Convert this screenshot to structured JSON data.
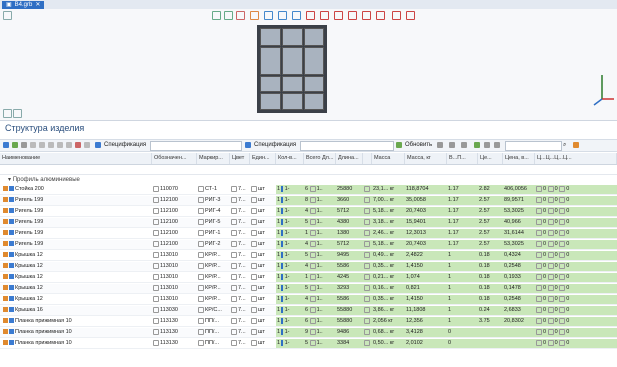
{
  "tab": {
    "title": "B4.grb",
    "close": "✕"
  },
  "panel": {
    "title": "Структура изделия"
  },
  "toolbar": {
    "spec_left": "Спецификация",
    "spec_right": "Спецификация",
    "refresh": "Обновить"
  },
  "columns": [
    "Наименование",
    "Обозначен...",
    "Маркир...",
    "Цвет",
    "Един...",
    "Кол-в...",
    "Всего Дл...",
    "Длина...",
    "",
    "Масса",
    "Масса, кг",
    "В...П...",
    "Це...",
    "Цена, в...",
    "Ц...Ц...Ц...Ц..."
  ],
  "group": "Профиль алюминиевые",
  "rows": [
    {
      "name": "Стойка 200",
      "code": "110070",
      "mark": "СТ-1",
      "unit": "шт",
      "qty": "1",
      "count": "6",
      "total": "25880",
      "len": "23,1... кг",
      "mass": "118,8704",
      "m2": "1.17",
      "price": "2.82",
      "sum": "406,0056"
    },
    {
      "name": "Ригель 199",
      "code": "112100",
      "mark": "РИГ-3",
      "unit": "шт",
      "qty": "1",
      "count": "8",
      "total": "3660",
      "len": "7,00... кг",
      "mass": "35,0058",
      "m2": "1.17",
      "price": "2.57",
      "sum": "89,9571"
    },
    {
      "name": "Ригель 199",
      "code": "112100",
      "mark": "РИГ-4",
      "unit": "шт",
      "qty": "1",
      "count": "4",
      "total": "5712",
      "len": "5,18... кг",
      "mass": "20,7403",
      "m2": "1.17",
      "price": "2.57",
      "sum": "53,3025"
    },
    {
      "name": "Ригель 199",
      "code": "112100",
      "mark": "РИГ-5",
      "unit": "шт",
      "qty": "1",
      "count": "5",
      "total": "4380",
      "len": "3,18... кг",
      "mass": "15,9401",
      "m2": "1.17",
      "price": "2.57",
      "sum": "40,966"
    },
    {
      "name": "Ригель 199",
      "code": "112100",
      "mark": "РИГ-1",
      "unit": "шт",
      "qty": "1",
      "count": "1",
      "total": "1380",
      "len": "2,46... кг",
      "mass": "12,3013",
      "m2": "1.17",
      "price": "2.57",
      "sum": "31,6144"
    },
    {
      "name": "Ригель 199",
      "code": "112100",
      "mark": "РИГ-2",
      "unit": "шт",
      "qty": "1",
      "count": "4",
      "total": "5712",
      "len": "5,18... кг",
      "mass": "20,7403",
      "m2": "1.17",
      "price": "2.57",
      "sum": "53,3025"
    },
    {
      "name": "Крышка 12",
      "code": "113010",
      "mark": "КР/Р...",
      "unit": "шт",
      "qty": "1",
      "count": "5",
      "total": "9495",
      "len": "0,49... кг",
      "mass": "2,4822",
      "m2": "1",
      "price": "0.18",
      "sum": "0,4324"
    },
    {
      "name": "Крышка 12",
      "code": "113010",
      "mark": "КР/Р...",
      "unit": "шт",
      "qty": "1",
      "count": "4",
      "total": "5586",
      "len": "0,35... кг",
      "mass": "1,4150",
      "m2": "1",
      "price": "0.18",
      "sum": "0,2548"
    },
    {
      "name": "Крышка 12",
      "code": "113010",
      "mark": "КР/Р...",
      "unit": "шт",
      "qty": "1",
      "count": "1",
      "total": "4245",
      "len": "0,21... кг",
      "mass": "1,074",
      "m2": "1",
      "price": "0.18",
      "sum": "0,1933"
    },
    {
      "name": "Крышка 12",
      "code": "113010",
      "mark": "КР/Р...",
      "unit": "шт",
      "qty": "1",
      "count": "5",
      "total": "3293",
      "len": "0,16... кг",
      "mass": "0,821",
      "m2": "1",
      "price": "0.18",
      "sum": "0,1478"
    },
    {
      "name": "Крышка 12",
      "code": "113010",
      "mark": "КР/Р...",
      "unit": "шт",
      "qty": "1",
      "count": "4",
      "total": "5586",
      "len": "0,35... кг",
      "mass": "1,4150",
      "m2": "1",
      "price": "0.18",
      "sum": "0,2548"
    },
    {
      "name": "Крышка 16",
      "code": "113030",
      "mark": "КР/С...",
      "unit": "шт",
      "qty": "1",
      "count": "6",
      "total": "55880",
      "len": "3,86... кг",
      "mass": "11,1808",
      "m2": "1",
      "price": "0.24",
      "sum": "2,6833"
    },
    {
      "name": "Планка прижимная 10",
      "code": "113130",
      "mark": "ПП/...",
      "unit": "шт",
      "qty": "1",
      "count": "6",
      "total": "55880",
      "len": "2,056 кг",
      "mass": "12,356",
      "m2": "1",
      "price": "3.75",
      "sum": "20,8302"
    },
    {
      "name": "Планка прижимная 10",
      "code": "113130",
      "mark": "ПП/...",
      "unit": "шт",
      "qty": "1",
      "count": "9",
      "total": "9486",
      "len": "0,68... кг",
      "mass": "3,4128",
      "m2": "0",
      "price": "",
      "sum": ""
    },
    {
      "name": "Планка прижимная 10",
      "code": "113130",
      "mark": "ПП/...",
      "unit": "шт",
      "qty": "1",
      "count": "5",
      "total": "3384",
      "len": "0,50... кг",
      "mass": "2,0102",
      "m2": "0",
      "price": "",
      "sum": ""
    }
  ]
}
